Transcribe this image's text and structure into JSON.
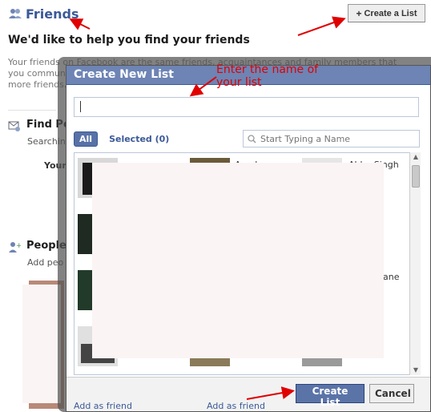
{
  "page": {
    "title": "Friends",
    "create_list_button": "Create a List",
    "help_heading": "We'd like to help you find your friends",
    "intro_text": "Your friends on Facebook are the same friends, acquaintances and family members that you communicate with in the real world. You can use any of the tools on this page to find more friends.",
    "find_title": "Find Pe",
    "find_sub": "Searchin",
    "your_label": "Your",
    "people_title": "People",
    "people_sub": "Add peo",
    "add_as_friend_1": "Add as friend",
    "add_as_friend_2": "Add as friend"
  },
  "dialog": {
    "title": "Create New List",
    "list_name_value": "",
    "tabs": {
      "all": "All",
      "selected": "Selected (0)"
    },
    "search_placeholder": "Start Typing a Name",
    "friends": [
      {
        "name": ""
      },
      {
        "name": "Amula"
      },
      {
        "name": "Abha Singh"
      },
      {
        "name": ""
      },
      {
        "name": "y"
      },
      {
        "name": "Kane"
      }
    ],
    "create_button": "Create List",
    "cancel_button": "Cancel"
  },
  "annotation": {
    "text": "Enter the name of your list",
    "color": "#e00000"
  },
  "colors": {
    "brand": "#3b5998",
    "titlebar": "#6d84b4",
    "primary_button": "#5b74a8"
  }
}
